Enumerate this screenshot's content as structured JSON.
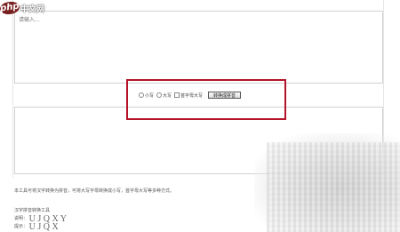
{
  "brand": {
    "logo_text": "php",
    "site_name": "中文网"
  },
  "input_area": {
    "placeholder": "请输入..."
  },
  "controls": {
    "option_lowercase": "小写",
    "option_uppercase": "大写",
    "option_first_letter": "首字母大写",
    "convert_button": "转换成拼音"
  },
  "output_area": {
    "content": ""
  },
  "description": {
    "line1": "本工具可将汉字转换为拼音，可将大写字母转换成小写，首字母大写等多种方式。",
    "line2_prefix": "汉字拼音转换工具",
    "line3_prefix": "说明：",
    "line3_big": "U J Q X Y",
    "line4_prefix": "提示：",
    "line4_big": "U  J  Q  X"
  },
  "colors": {
    "highlight_border": "#b3142a",
    "brand_badge": "#7a2020"
  }
}
